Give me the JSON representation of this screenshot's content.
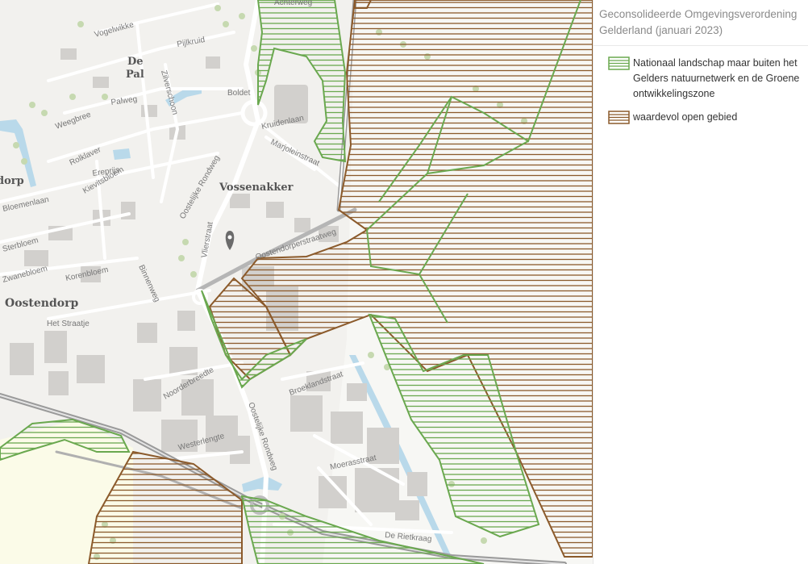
{
  "legend": {
    "title": "Geconsolideerde Omgevingsverordening Gelderland (januari 2023)",
    "items": [
      {
        "label": "Nationaal landschap maar buiten het Gelders natuurnetwerk en de Groene ontwikkelingszone",
        "color": "#6aa84f"
      },
      {
        "label": "waardevol open gebied",
        "color": "#8b5a2b"
      }
    ]
  },
  "map": {
    "places": {
      "de_pal_1": "De",
      "de_pal_2": "Pal",
      "vossenakker": "Vossenakker",
      "oostendorp": "Oostendorp",
      "dorp_fragment": "dorp"
    },
    "streets": {
      "achterweg": "Achterweg",
      "vogelwikke": "Vogelwikke",
      "pijlkruid": "Pijlkruid",
      "zilverschoon": "Zilverschoon",
      "boldet": "Boldet",
      "palweg": "Palweg",
      "weegbree": "Weegbree",
      "rolklaver": "Rolklaver",
      "ereprijs": "Ereprijs",
      "kruidenlaan": "Kruidenlaan",
      "marjoleinstraat": "Marjoleinstraat",
      "oostelijke_rondweg_north": "Oostelijke Rondweg",
      "bloemenlaan": "Bloemenlaan",
      "kievitsbloem": "Kievitsbloem",
      "sterbloem": "Sterbloem",
      "vlierstraat": "Vlierstraat",
      "oostendorperstraatweg": "Oostendorperstraatweg",
      "zwanebloem": "Zwanebloem",
      "korenbloem": "Korenbloem",
      "binnenweg": "Binnenweg",
      "het_straatje": "Het Straatje",
      "broeklandstraat": "Broeklandstraat",
      "noorderbreedte": "Noorderbreedte",
      "oostelijke_rondweg_south": "Oostelijke Rondweg",
      "westerlengte": "Westerlengte",
      "moerasstraat": "Moerasstraat",
      "de_rietkraag": "De Rietkraag"
    },
    "marker": "location-pin-icon"
  }
}
